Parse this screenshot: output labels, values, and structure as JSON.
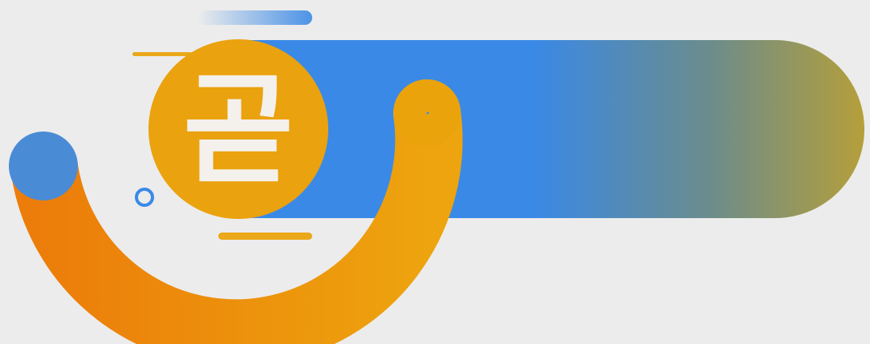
{
  "badge": {
    "character": "곧"
  },
  "colors": {
    "background": "#ececec",
    "banner_blue": "#3a89e6",
    "banner_gold": "#b59f3a",
    "circle_gold": "#eaa20e",
    "arc_orange": "#ec8510",
    "ball_blue": "#4a8bd6",
    "accent_gold": "#eaa81a"
  },
  "icons": [
    "swoosh-arc",
    "blue-ball",
    "ring-outline",
    "speed-lines"
  ]
}
